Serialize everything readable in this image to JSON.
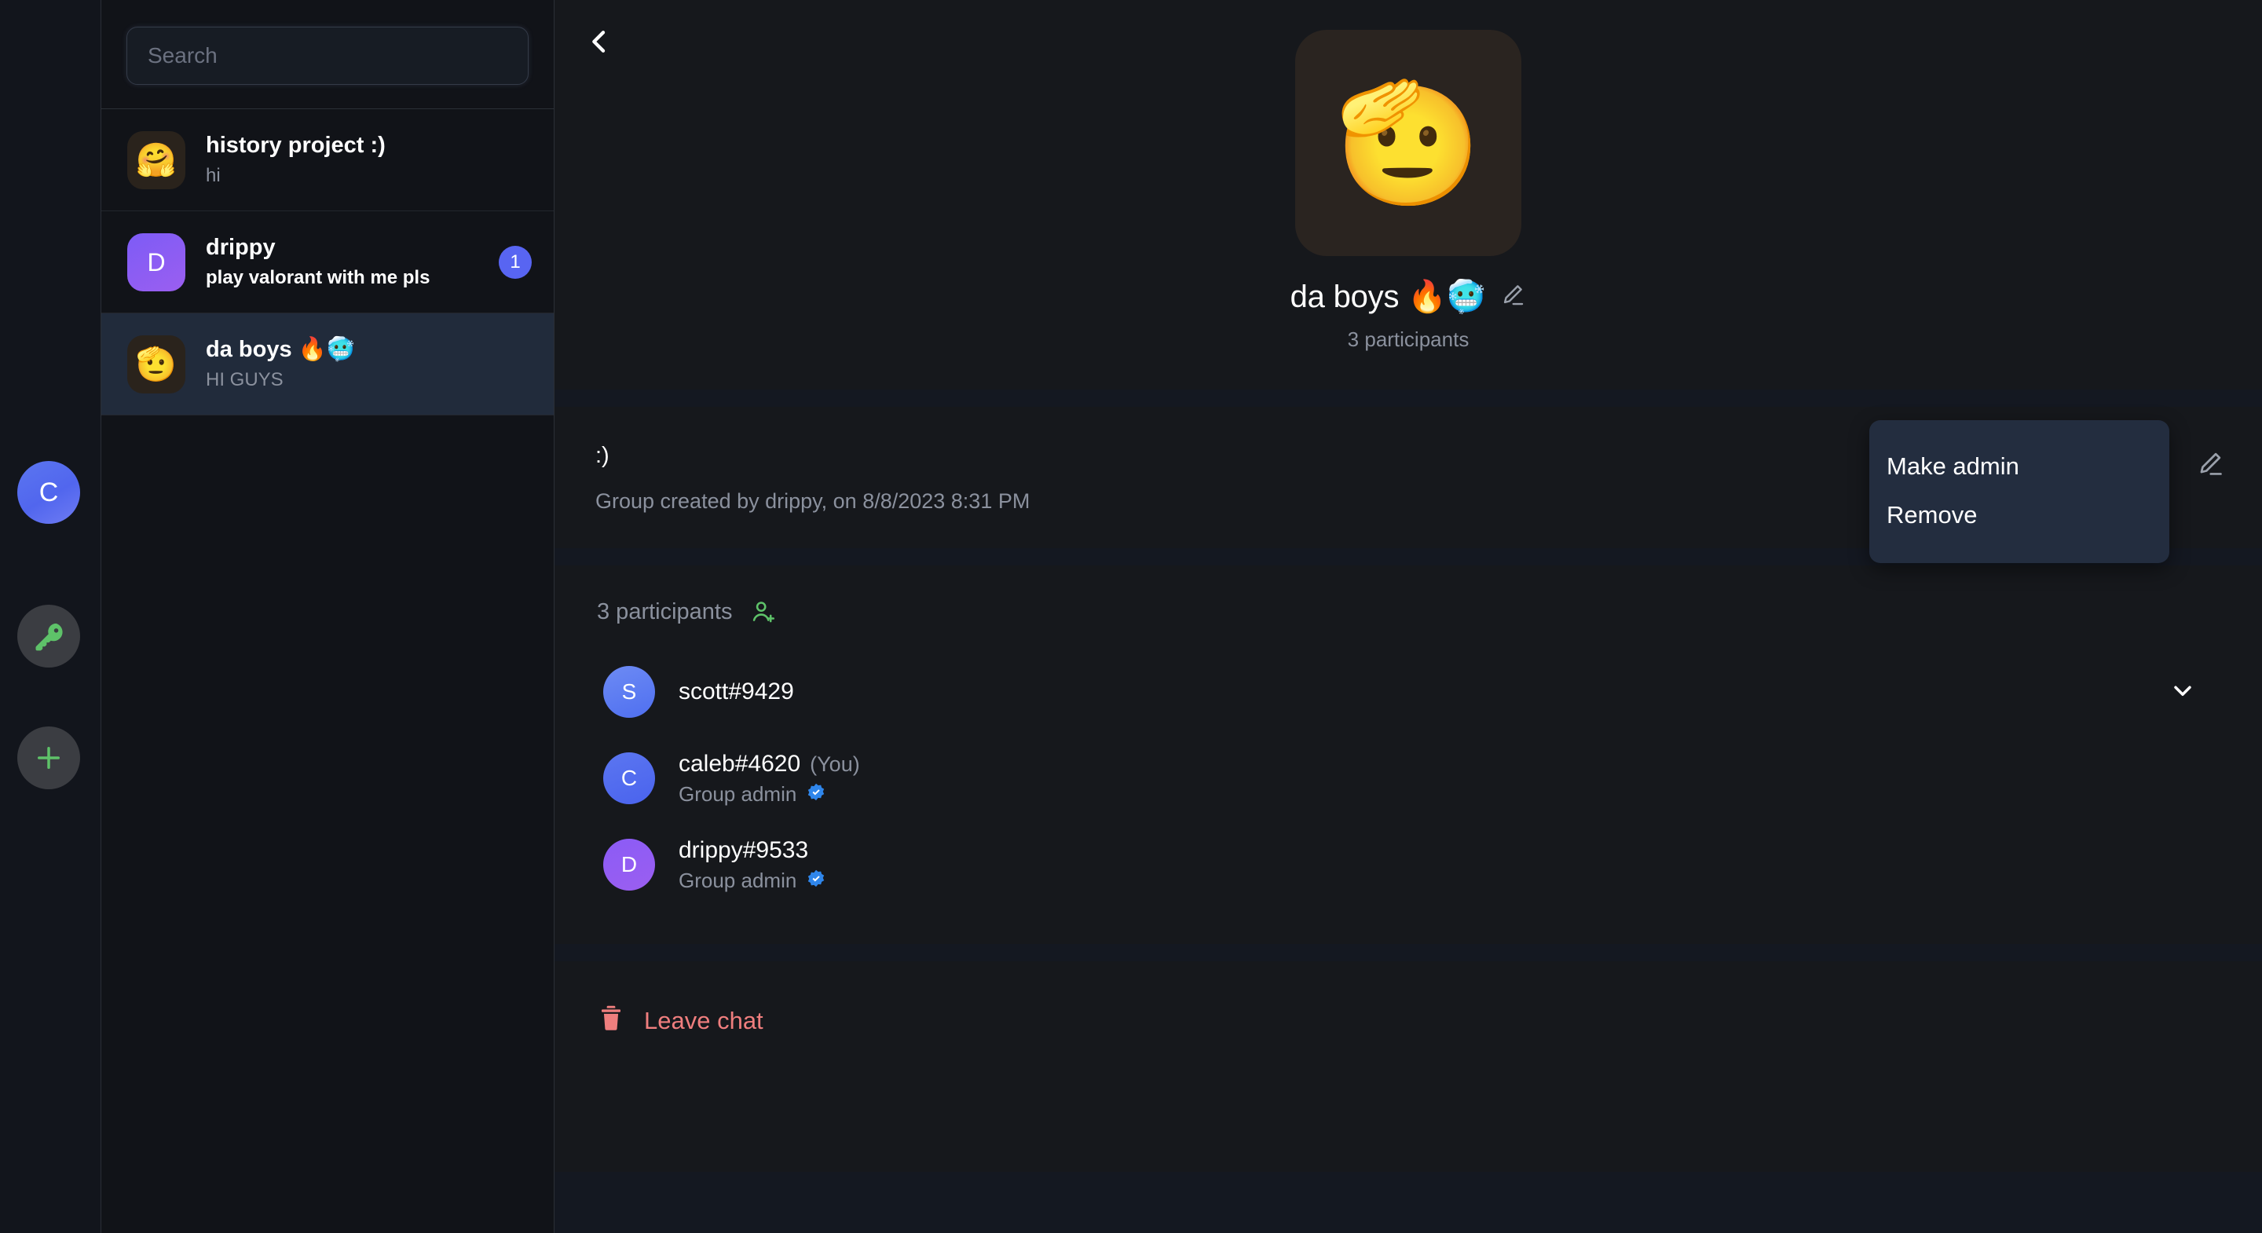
{
  "left_rail": {
    "items": [
      {
        "name": "user-avatar",
        "icon": "avatar-letter",
        "label": "C"
      },
      {
        "name": "key",
        "icon": "key-icon",
        "label": ""
      },
      {
        "name": "add",
        "icon": "plus-icon",
        "label": ""
      }
    ],
    "avatar_color": "#5566ee",
    "icon_color": "#5ec269"
  },
  "sidebar": {
    "search": {
      "placeholder": "Search",
      "value": ""
    },
    "chats": [
      {
        "title": "history project :)",
        "preview": "hi",
        "avatar_type": "emoji",
        "avatar": "🤗",
        "avatar_bg": "#2a231c",
        "unread": false,
        "badge": "",
        "selected": false
      },
      {
        "title": "drippy",
        "preview": "play valorant with me pls",
        "avatar_type": "letter",
        "avatar": "D",
        "avatar_bg": "#8b5cf6",
        "unread": true,
        "badge": "1",
        "selected": false
      },
      {
        "title": "da boys 🔥🥶",
        "preview": "HI GUYS",
        "avatar_type": "emoji",
        "avatar": "🫡",
        "avatar_bg": "#2a2420",
        "unread": false,
        "badge": "",
        "selected": true
      }
    ]
  },
  "main": {
    "back_label": "‹",
    "group": {
      "avatar_emoji": "🫡",
      "name": "da boys 🔥🥶",
      "participants_caption": "3 participants"
    },
    "description": {
      "text": ":)",
      "created": "Group created by drippy, on 8/8/2023 8:31 PM"
    },
    "participants": {
      "heading": "3 participants",
      "members": [
        {
          "name": "scott#9429",
          "initial": "S",
          "avatar_class": "av-scott",
          "you": "",
          "role": "",
          "verified": false,
          "has_caret": true
        },
        {
          "name": "caleb#4620",
          "initial": "C",
          "avatar_class": "av-caleb",
          "you": "(You)",
          "role": "Group admin",
          "verified": true,
          "has_caret": false
        },
        {
          "name": "drippy#9533",
          "initial": "D",
          "avatar_class": "av-drippy",
          "you": "",
          "role": "Group admin",
          "verified": true,
          "has_caret": false
        }
      ]
    },
    "leave": {
      "label": "Leave chat",
      "color": "#ef7e7e"
    }
  },
  "context_menu": {
    "items": [
      {
        "label": "Make admin"
      },
      {
        "label": "Remove"
      }
    ]
  },
  "colors": {
    "accent_blue": "#5865f2",
    "accent_green": "#5ec269",
    "danger": "#ef7e7e",
    "selected_row": "#212b3b",
    "menu_bg": "#232d3f"
  }
}
